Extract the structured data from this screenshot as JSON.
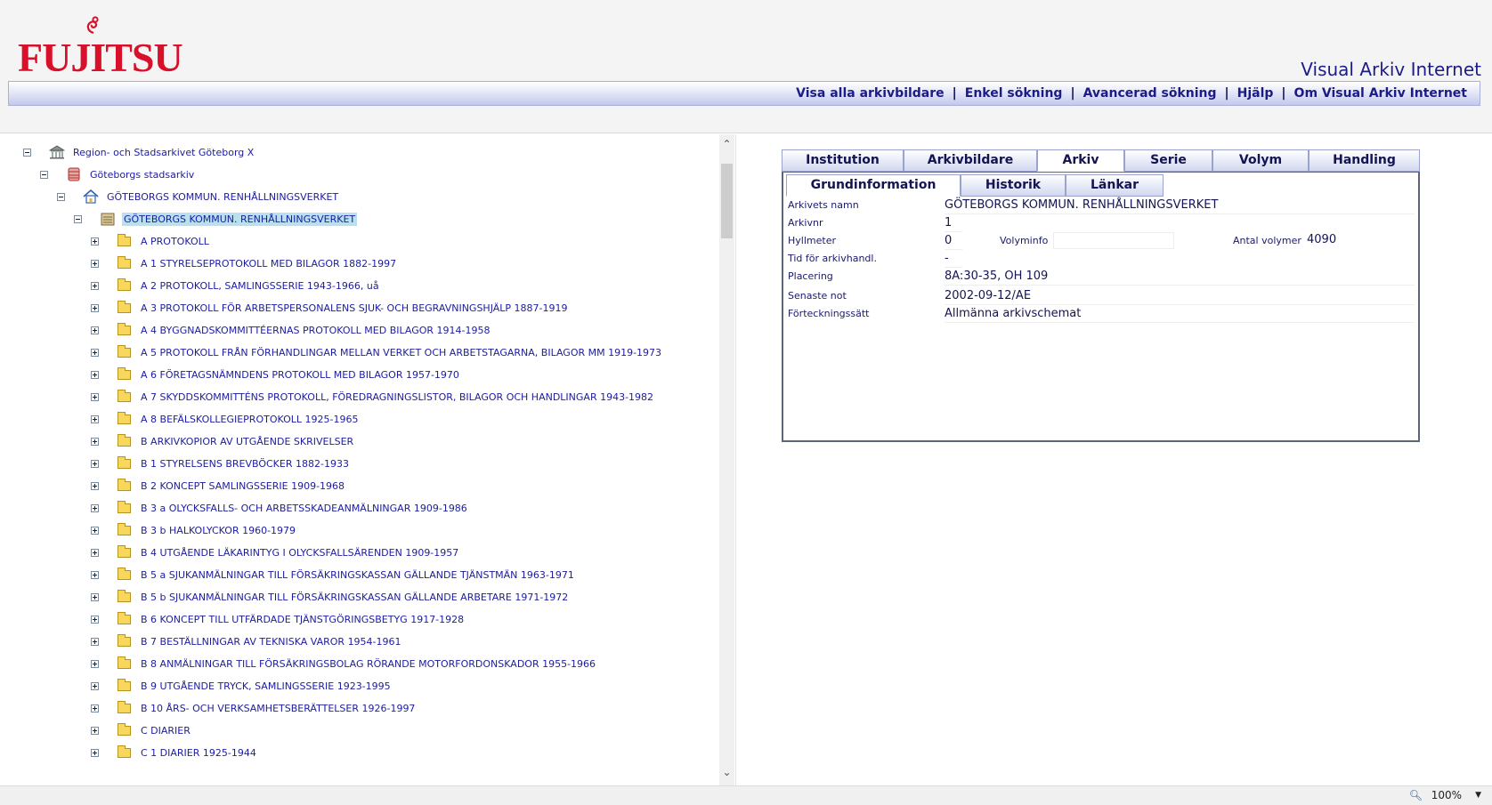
{
  "header": {
    "logo_text": "FUJITSU",
    "app_title": "Visual Arkiv Internet",
    "nav": [
      "Visa alla arkivbildare",
      "Enkel sökning",
      "Avancerad sökning",
      "Hjälp",
      "Om Visual Arkiv Internet"
    ],
    "separator": "|"
  },
  "tree": {
    "nodes": [
      {
        "label": "Region- och Stadsarkivet Göteborg X",
        "level": 0,
        "toggle": "minus",
        "icon": "institution-icon"
      },
      {
        "label": "Göteborgs stadsarkiv",
        "level": 1,
        "toggle": "minus",
        "icon": "archive-database-icon"
      },
      {
        "label": "GÖTEBORGS KOMMUN. RENHÅLLNINGSVERKET",
        "level": 2,
        "toggle": "minus",
        "icon": "organization-house-icon"
      },
      {
        "label": "GÖTEBORGS KOMMUN. RENHÅLLNINGSVERKET",
        "level": 3,
        "toggle": "minus",
        "icon": "archive-box-icon",
        "selected": true
      },
      {
        "label": "A PROTOKOLL",
        "level": 4,
        "toggle": "plus",
        "icon": "folder-icon"
      },
      {
        "label": "A 1 STYRELSEPROTOKOLL MED BILAGOR 1882-1997",
        "level": 4,
        "toggle": "plus",
        "icon": "folder-icon"
      },
      {
        "label": "A 2 PROTOKOLL, SAMLINGSSERIE 1943-1966, uå",
        "level": 4,
        "toggle": "plus",
        "icon": "folder-icon"
      },
      {
        "label": "A 3 PROTOKOLL FÖR ARBETSPERSONALENS SJUK- OCH BEGRAVNINGSHJÄLP 1887-1919",
        "level": 4,
        "toggle": "plus",
        "icon": "folder-icon"
      },
      {
        "label": "A 4 BYGGNADSKOMMITTÉERNAS PROTOKOLL MED BILAGOR 1914-1958",
        "level": 4,
        "toggle": "plus",
        "icon": "folder-icon"
      },
      {
        "label": "A 5 PROTOKOLL FRÅN FÖRHANDLINGAR MELLAN VERKET OCH ARBETSTAGARNA, BILAGOR MM 1919-1973",
        "level": 4,
        "toggle": "plus",
        "icon": "folder-icon"
      },
      {
        "label": "A 6 FÖRETAGSNÄMNDENS PROTOKOLL MED BILAGOR 1957-1970",
        "level": 4,
        "toggle": "plus",
        "icon": "folder-icon"
      },
      {
        "label": "A 7 SKYDDSKOMMITTÉNS PROTOKOLL, FÖREDRAGNINGSLISTOR, BILAGOR OCH HANDLINGAR 1943-1982",
        "level": 4,
        "toggle": "plus",
        "icon": "folder-icon"
      },
      {
        "label": "A 8 BEFÄLSKOLLEGIEPROTOKOLL 1925-1965",
        "level": 4,
        "toggle": "plus",
        "icon": "folder-icon"
      },
      {
        "label": "B ARKIVKOPIOR AV UTGÅENDE SKRIVELSER",
        "level": 4,
        "toggle": "plus",
        "icon": "folder-icon"
      },
      {
        "label": "B 1 STYRELSENS BREVBÖCKER 1882-1933",
        "level": 4,
        "toggle": "plus",
        "icon": "folder-icon"
      },
      {
        "label": "B 2 KONCEPT SAMLINGSSERIE 1909-1968",
        "level": 4,
        "toggle": "plus",
        "icon": "folder-icon"
      },
      {
        "label": "B 3 a OLYCKSFALLS- OCH ARBETSSKADEANMÄLNINGAR 1909-1986",
        "level": 4,
        "toggle": "plus",
        "icon": "folder-icon"
      },
      {
        "label": "B 3 b HALKOLYCKOR 1960-1979",
        "level": 4,
        "toggle": "plus",
        "icon": "folder-icon"
      },
      {
        "label": "B 4 UTGÅENDE LÄKARINTYG I OLYCKSFALLSÄRENDEN 1909-1957",
        "level": 4,
        "toggle": "plus",
        "icon": "folder-icon"
      },
      {
        "label": "B 5 a SJUKANMÄLNINGAR TILL FÖRSÄKRINGSKASSAN GÄLLANDE TJÄNSTMÄN 1963-1971",
        "level": 4,
        "toggle": "plus",
        "icon": "folder-icon"
      },
      {
        "label": "B 5 b SJUKANMÄLNINGAR TILL FÖRSÄKRINGSKASSAN GÄLLANDE ARBETARE 1971-1972",
        "level": 4,
        "toggle": "plus",
        "icon": "folder-icon"
      },
      {
        "label": "B 6 KONCEPT TILL UTFÄRDADE TJÄNSTGÖRINGSBETYG 1917-1928",
        "level": 4,
        "toggle": "plus",
        "icon": "folder-icon"
      },
      {
        "label": "B 7 BESTÄLLNINGAR AV TEKNISKA VAROR 1954-1961",
        "level": 4,
        "toggle": "plus",
        "icon": "folder-icon"
      },
      {
        "label": "B 8 ANMÄLNINGAR TILL FÖRSÄKRINGSBOLAG RÖRANDE MOTORFORDONSKADOR 1955-1966",
        "level": 4,
        "toggle": "plus",
        "icon": "folder-icon"
      },
      {
        "label": "B 9 UTGÅENDE TRYCK, SAMLINGSSERIE 1923-1995",
        "level": 4,
        "toggle": "plus",
        "icon": "folder-icon"
      },
      {
        "label": "B 10 ÅRS- OCH VERKSAMHETSBERÄTTELSER 1926-1997",
        "level": 4,
        "toggle": "plus",
        "icon": "folder-icon"
      },
      {
        "label": "C DIARIER",
        "level": 4,
        "toggle": "plus",
        "icon": "folder-icon"
      },
      {
        "label": "C 1 DIARIER 1925-1944",
        "level": 4,
        "toggle": "plus",
        "icon": "folder-icon"
      }
    ]
  },
  "detail": {
    "main_tabs": [
      "Institution",
      "Arkivbildare",
      "Arkiv",
      "Serie",
      "Volym",
      "Handling"
    ],
    "active_main_tab": "Arkiv",
    "sub_tabs": [
      "Grundinformation",
      "Historik",
      "Länkar"
    ],
    "active_sub_tab": "Grundinformation",
    "fields": {
      "arkivets_namn": {
        "label": "Arkivets namn",
        "value": "GÖTEBORGS KOMMUN. RENHÅLLNINGSVERKET"
      },
      "arkivnr": {
        "label": "Arkivnr",
        "value": "1"
      },
      "hyllmeter": {
        "label": "Hyllmeter",
        "value": "0"
      },
      "volyminfo": {
        "label": "Volyminfo",
        "value": ""
      },
      "antal_volymer": {
        "label": "Antal volymer",
        "value": "4090"
      },
      "tid": {
        "label": "Tid för arkivhandl.",
        "value": "-"
      },
      "placering": {
        "label": "Placering",
        "value": "8A:30-35, OH 109"
      },
      "senaste_not": {
        "label": "Senaste not",
        "value": "2002-09-12/AE"
      },
      "forteckningssatt": {
        "label": "Förteckningssätt",
        "value": "Allmänna arkivschemat"
      }
    }
  },
  "statusbar": {
    "zoom": "100%"
  },
  "colors": {
    "link": "#1c1ca0",
    "brand_red": "#d8102a",
    "selected_bg": "#b8e0ee",
    "folder": "#f7d85c"
  }
}
